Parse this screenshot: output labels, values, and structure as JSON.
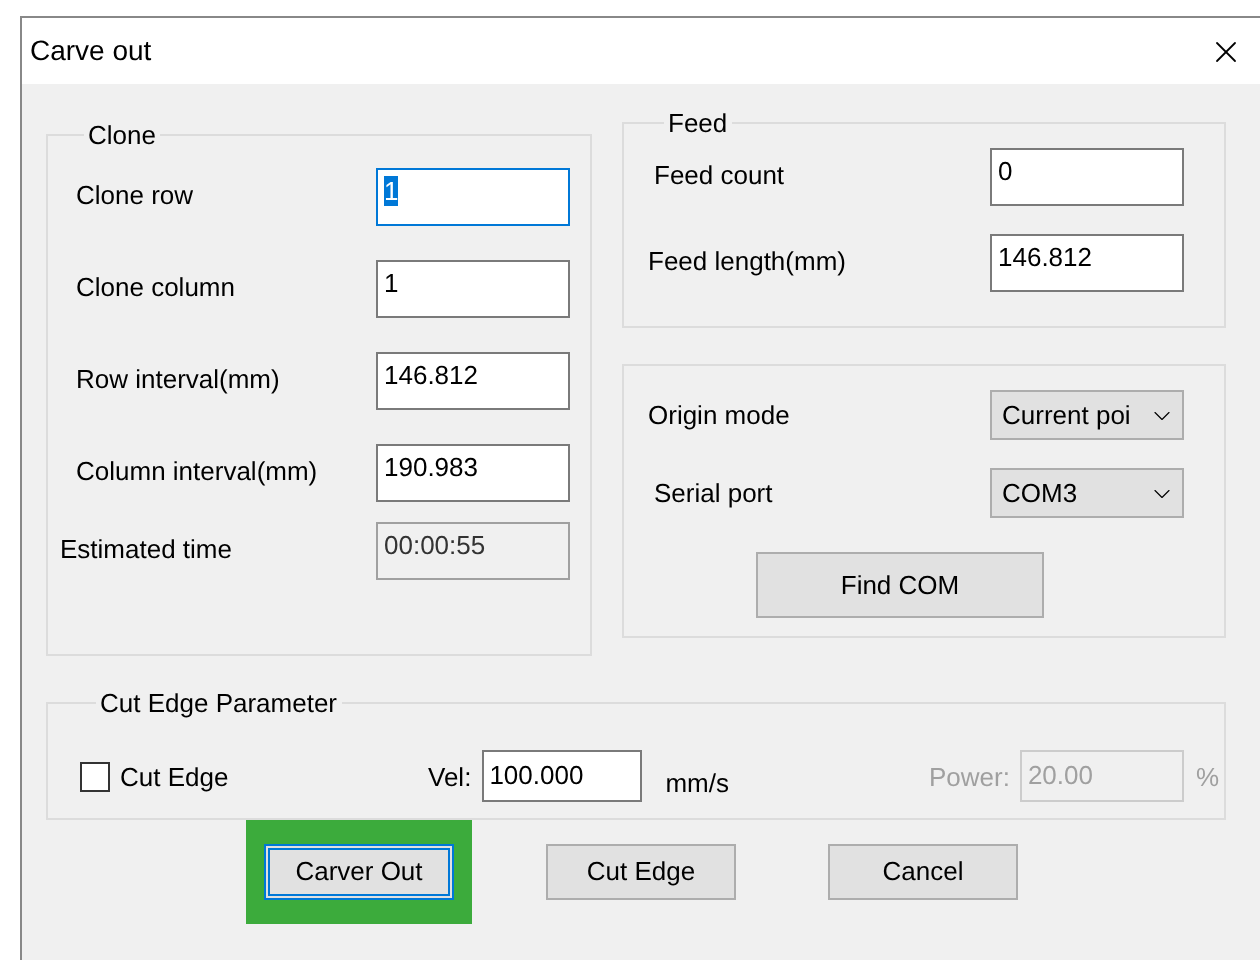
{
  "window": {
    "title": "Carve out"
  },
  "clone": {
    "title": "Clone",
    "fields": [
      {
        "label": "Clone row",
        "value": "1",
        "focused": true,
        "disabled": false
      },
      {
        "label": "Clone column",
        "value": "1",
        "focused": false,
        "disabled": false
      },
      {
        "label": "Row interval(mm)",
        "value": "146.812",
        "focused": false,
        "disabled": false
      },
      {
        "label": "Column interval(mm)",
        "value": "190.983",
        "focused": false,
        "disabled": false
      },
      {
        "label": "Estimated time",
        "value": "00:00:55",
        "focused": false,
        "disabled": true
      }
    ]
  },
  "feed": {
    "title": "Feed",
    "fields": [
      {
        "label": "Feed count",
        "value": "0",
        "focused": false,
        "disabled": false
      },
      {
        "label": "Feed length(mm)",
        "value": "146.812",
        "focused": false,
        "disabled": false
      }
    ]
  },
  "port": {
    "selects": [
      {
        "label": "Origin mode",
        "value": "Current poi"
      },
      {
        "label": "Serial port",
        "value": "COM3"
      }
    ],
    "button": "Find COM"
  },
  "cut_edge": {
    "title": "Cut Edge Parameter",
    "checkbox": {
      "label": "Cut Edge",
      "checked": false
    },
    "vel": {
      "label": "Vel:",
      "value": "100.000",
      "unit": "mm/s",
      "disabled": false
    },
    "power": {
      "label": "Power:",
      "value": "20.00",
      "unit": "%",
      "disabled": true
    }
  },
  "buttons": [
    {
      "label": "Carver Out",
      "default": true,
      "highlighted": true
    },
    {
      "label": "Cut Edge",
      "default": false,
      "highlighted": false
    },
    {
      "label": "Cancel",
      "default": false,
      "highlighted": false
    }
  ]
}
